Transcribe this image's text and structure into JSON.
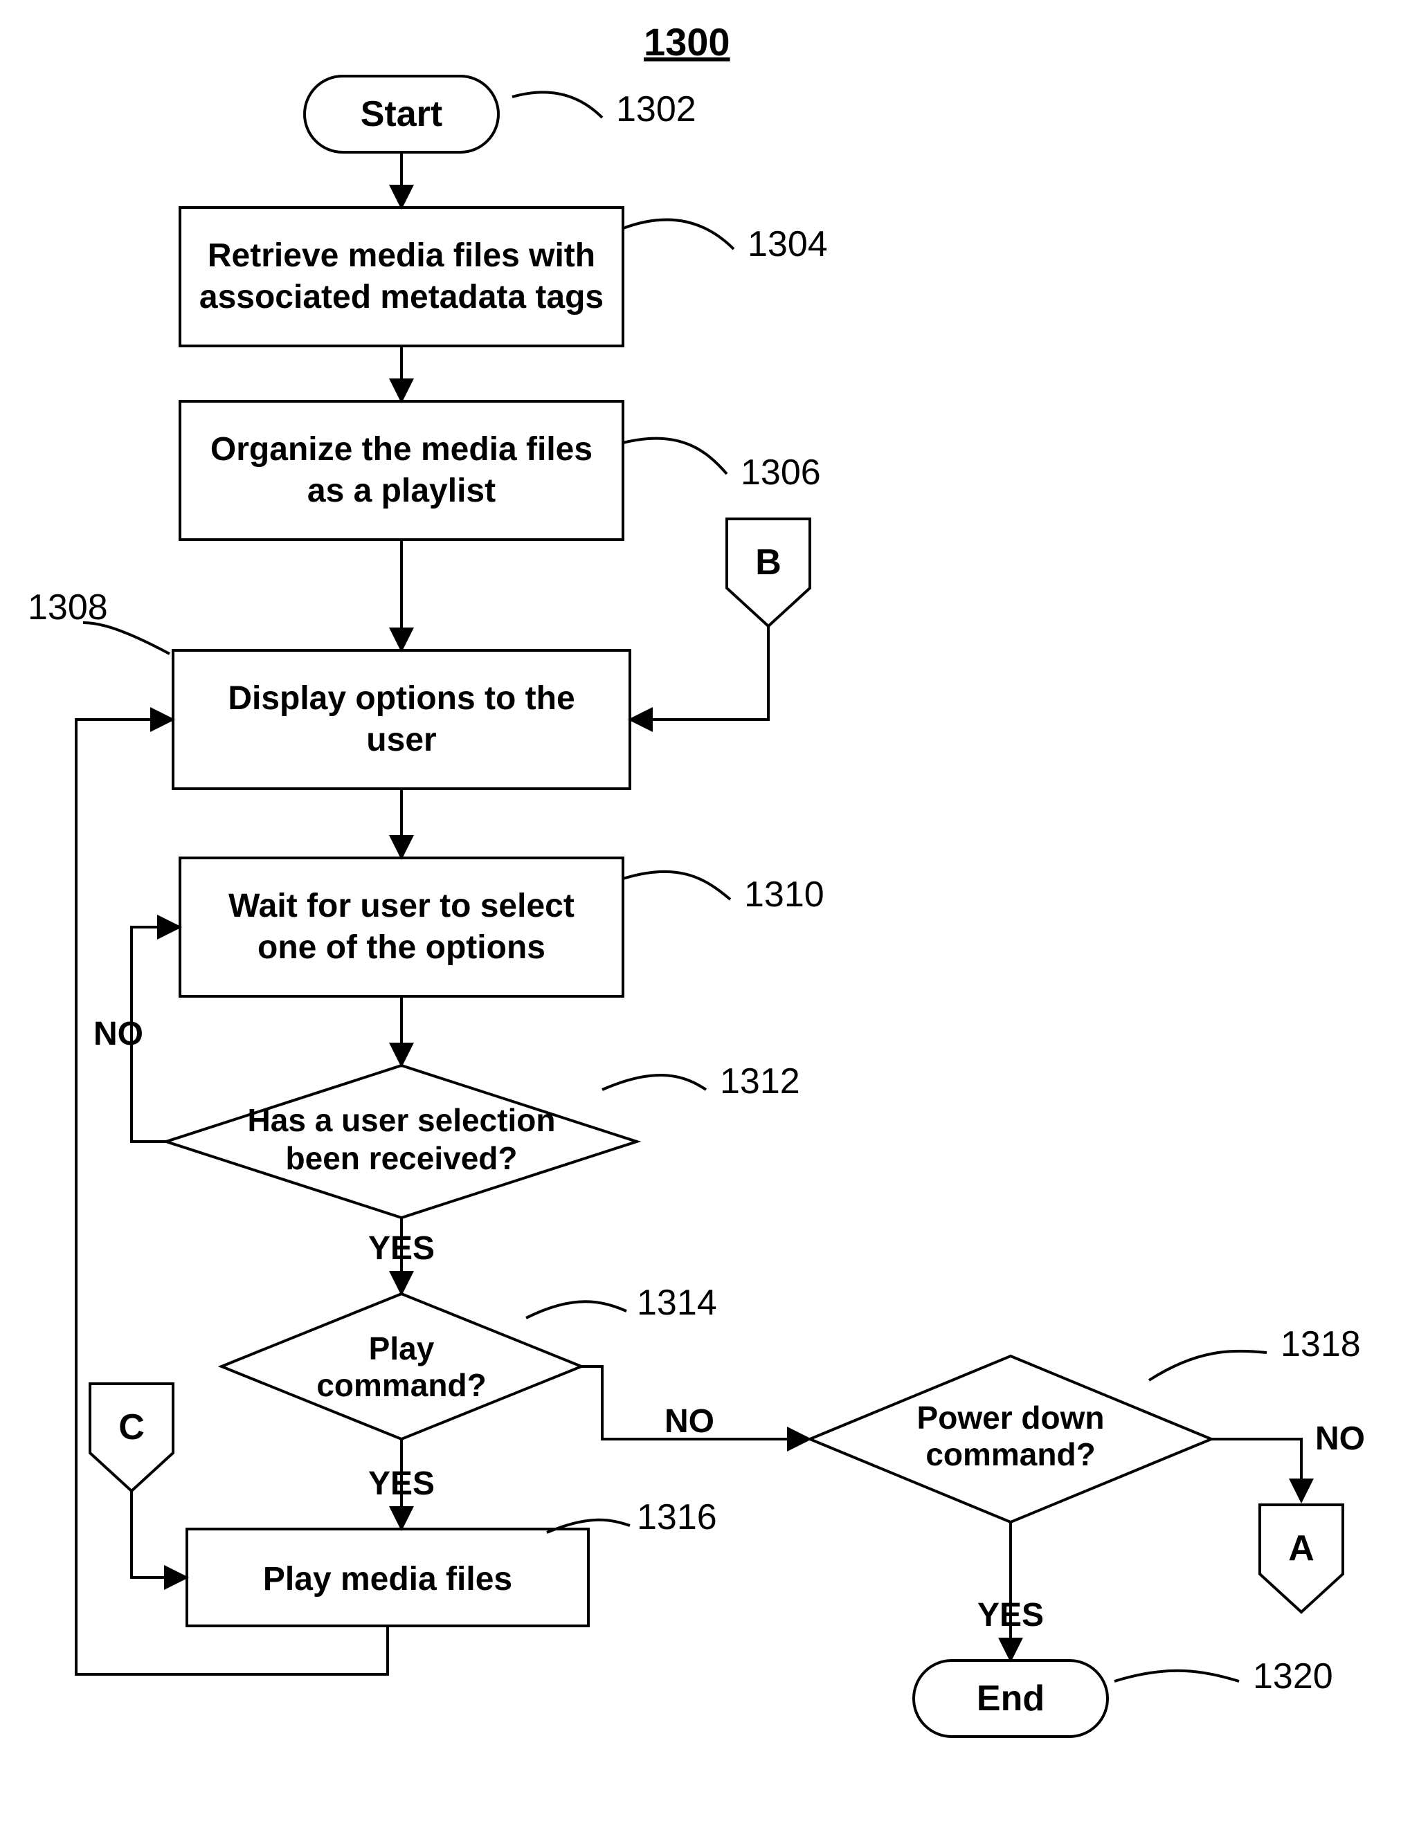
{
  "figure_number": "1300",
  "nodes": {
    "start": {
      "label": "Start",
      "ref": "1302",
      "type": "terminator"
    },
    "n1304": {
      "label": "Retrieve media files with associated metadata tags",
      "ref": "1304",
      "type": "process"
    },
    "n1306": {
      "label": "Organize the media files as a playlist",
      "ref": "1306",
      "type": "process"
    },
    "n1308": {
      "label": "Display options to the user",
      "ref": "1308",
      "type": "process"
    },
    "n1310": {
      "label": "Wait for user to select one of the options",
      "ref": "1310",
      "type": "process"
    },
    "n1312": {
      "label": "Has a user selection been received?",
      "ref": "1312",
      "type": "decision"
    },
    "n1314": {
      "label": "Play command?",
      "ref": "1314",
      "type": "decision"
    },
    "n1316": {
      "label": "Play media files",
      "ref": "1316",
      "type": "process"
    },
    "n1318": {
      "label": "Power down command?",
      "ref": "1318",
      "type": "decision"
    },
    "end": {
      "label": "End",
      "ref": "1320",
      "type": "terminator"
    },
    "connA": {
      "label": "A",
      "type": "offpage"
    },
    "connB": {
      "label": "B",
      "type": "offpage"
    },
    "connC": {
      "label": "C",
      "type": "offpage"
    }
  },
  "edges": {
    "n1312_yes": "YES",
    "n1312_no": "NO",
    "n1314_yes": "YES",
    "n1314_no": "NO",
    "n1318_yes": "YES",
    "n1318_no": "NO"
  },
  "flow": [
    {
      "from": "start",
      "to": "n1304"
    },
    {
      "from": "n1304",
      "to": "n1306"
    },
    {
      "from": "n1306",
      "to": "n1308"
    },
    {
      "from": "connB",
      "to": "n1308"
    },
    {
      "from": "n1308",
      "to": "n1310"
    },
    {
      "from": "n1310",
      "to": "n1312"
    },
    {
      "from": "n1312",
      "to": "n1314",
      "label": "YES"
    },
    {
      "from": "n1312",
      "to": "n1310",
      "label": "NO"
    },
    {
      "from": "n1314",
      "to": "n1316",
      "label": "YES"
    },
    {
      "from": "n1314",
      "to": "n1318",
      "label": "NO"
    },
    {
      "from": "connC",
      "to": "n1316"
    },
    {
      "from": "n1316",
      "to": "n1308"
    },
    {
      "from": "n1318",
      "to": "end",
      "label": "YES"
    },
    {
      "from": "n1318",
      "to": "connA",
      "label": "NO"
    }
  ]
}
